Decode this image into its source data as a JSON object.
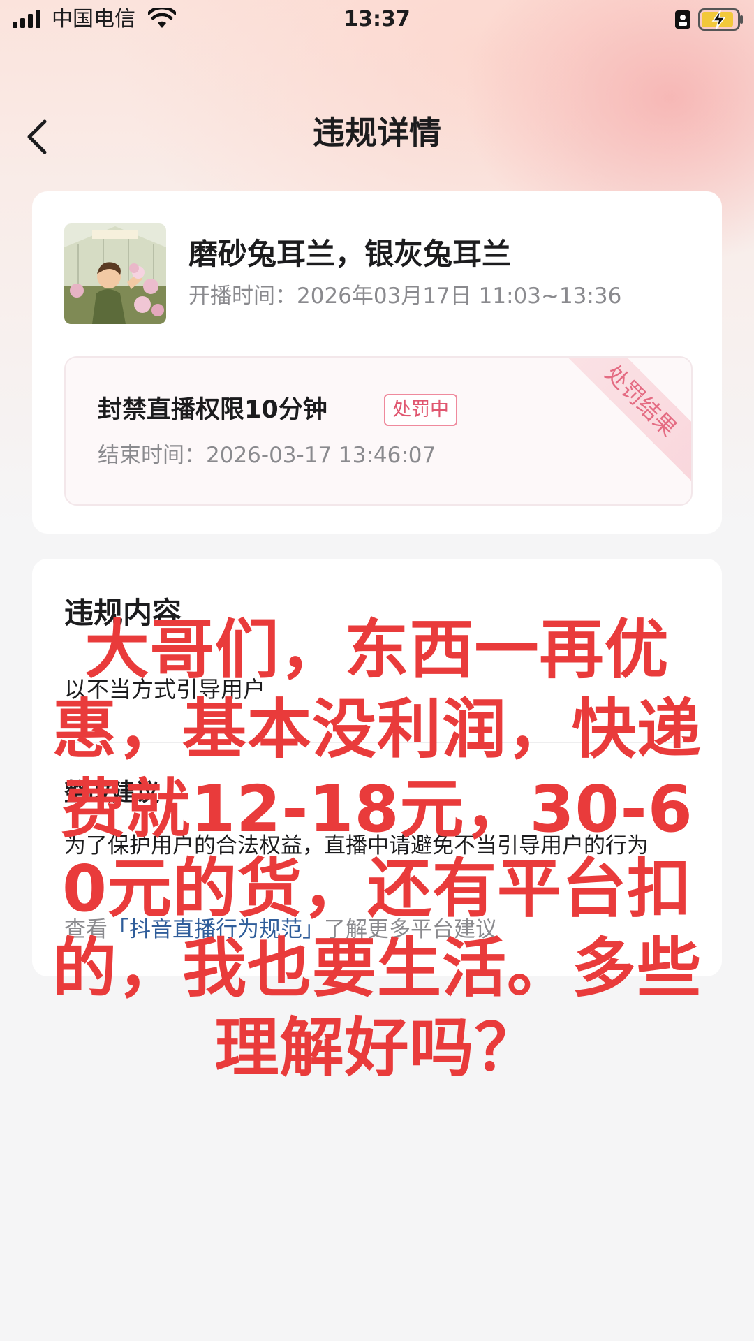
{
  "status_bar": {
    "carrier": "中国电信",
    "time": "13:37",
    "icons": [
      "signal-icon",
      "wifi-icon",
      "lock-icon",
      "battery-charging-icon"
    ]
  },
  "nav": {
    "back_icon": "chevron-left-icon",
    "title": "违规详情"
  },
  "live": {
    "thumbnail": "live-cover-image",
    "title": "磨砂兔耳兰，银灰兔耳兰",
    "time": "开播时间：2026年03月17日 11:03~13:36"
  },
  "penalty": {
    "ribbon": "处罚结果",
    "text": "封禁直播权限10分钟",
    "badge": "处罚中",
    "end_time": "结束时间：2026-03-17 13:46:07"
  },
  "violation": {
    "heading": "违规内容",
    "text": "以不当方式引导用户",
    "suggest_heading": "整改建议",
    "suggest_text": "为了保护用户的合法权益，直播中请避免不当引导用户的行为",
    "rule_prefix": "查看",
    "rule_link": "「抖音直播行为规范」",
    "rule_suffix": "了解更多平台建议"
  },
  "overlay": {
    "caption": "大哥们，东西一再优惠，基本没利润，快递费就12-18元，30-60元的货，还有平台扣的，我也要生活。多些理解好吗？"
  },
  "colors": {
    "accent_pink": "#e0566f",
    "link_blue": "#2f5d9a",
    "overlay_red": "#e93b3b"
  }
}
